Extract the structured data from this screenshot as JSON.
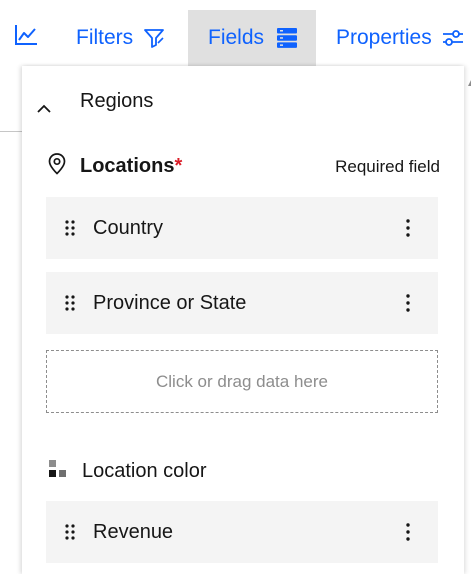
{
  "toolbar": {
    "chart_icon": "line-chart-icon",
    "filters_label": "Filters",
    "filters_icon": "filter-icon",
    "fields_label": "Fields",
    "fields_icon": "fields-stack-icon",
    "properties_label": "Properties",
    "properties_icon": "settings-adjust-icon",
    "accent_color": "#0f62fe",
    "active_tab_background": "#e0e0e0"
  },
  "panel": {
    "section": {
      "title": "Regions",
      "icon": "chevron-up-icon",
      "expanded": true
    },
    "locations": {
      "label": "Locations",
      "required_marker": "*",
      "required_text": "Required field",
      "icon": "location-pin-icon",
      "fields": [
        {
          "name": "Country"
        },
        {
          "name": "Province or State"
        }
      ],
      "dropzone_text": "Click or drag data here"
    },
    "location_color": {
      "label": "Location color",
      "icon": "color-squares-icon",
      "fields": [
        {
          "name": "Revenue"
        }
      ]
    },
    "field_icons": {
      "drag": "drag-handle-icon",
      "menu": "overflow-menu-icon"
    },
    "required_color": "#da1e28"
  }
}
